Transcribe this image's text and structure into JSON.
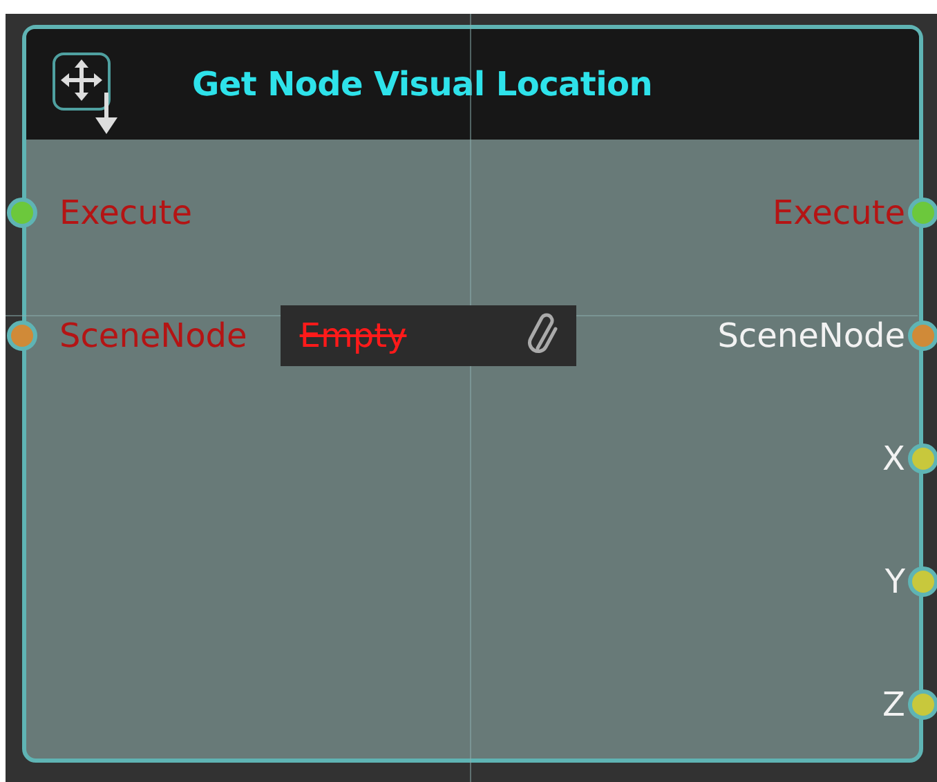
{
  "node": {
    "title": "Get Node Visual Location",
    "inputs": [
      {
        "label": "Execute",
        "highlighted": true,
        "color": "#6cc83c"
      },
      {
        "label": "SceneNode",
        "highlighted": true,
        "color": "#d08a38",
        "field": {
          "value": "Empty"
        }
      }
    ],
    "outputs": [
      {
        "label": "Execute",
        "highlighted": true,
        "color": "#6cc83c"
      },
      {
        "label": "SceneNode",
        "highlighted": false,
        "color": "#d08a38"
      },
      {
        "label": "X",
        "highlighted": false,
        "color": "#c8c83c"
      },
      {
        "label": "Y",
        "highlighted": false,
        "color": "#c8c83c"
      },
      {
        "label": "Z",
        "highlighted": false,
        "color": "#c8c83c"
      }
    ]
  }
}
